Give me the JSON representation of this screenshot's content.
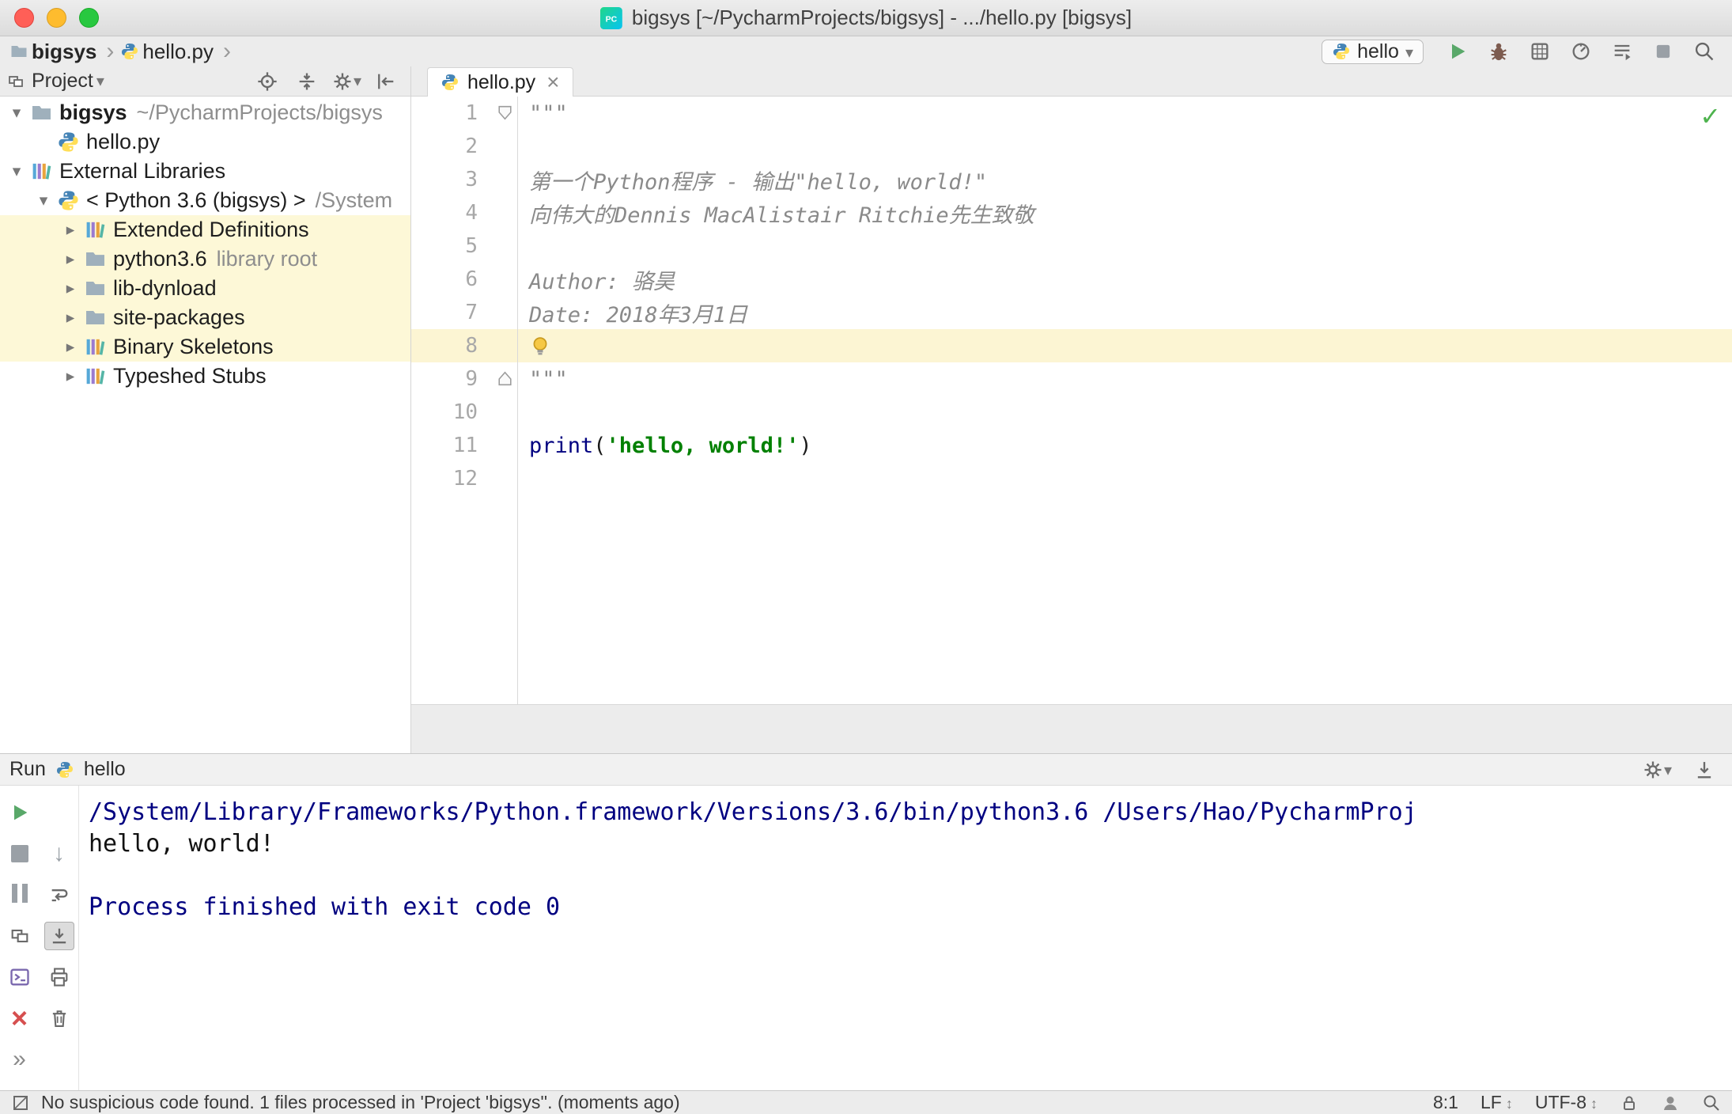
{
  "window": {
    "title": "bigsys [~/PycharmProjects/bigsys] - .../hello.py [bigsys]"
  },
  "navbar": {
    "breadcrumbs": [
      {
        "label": "bigsys"
      },
      {
        "label": "hello.py"
      }
    ],
    "run_config": {
      "label": "hello"
    }
  },
  "project_panel": {
    "title": "Project",
    "tree": [
      {
        "label": "bigsys",
        "suffix": "~/PycharmProjects/bigsys"
      },
      {
        "label": "hello.py"
      },
      {
        "label": "External Libraries"
      },
      {
        "label": "< Python 3.6 (bigsys) >",
        "suffix": "/System"
      },
      {
        "label": "Extended Definitions"
      },
      {
        "label": "python3.6",
        "suffix": "library root"
      },
      {
        "label": "lib-dynload"
      },
      {
        "label": "site-packages"
      },
      {
        "label": "Binary Skeletons"
      },
      {
        "label": "Typeshed Stubs"
      }
    ]
  },
  "editor": {
    "tab": "hello.py",
    "lines": [
      {
        "num": 1,
        "segments": [
          {
            "text": "\"\"\"",
            "style": "doc"
          }
        ]
      },
      {
        "num": 2,
        "segments": []
      },
      {
        "num": 3,
        "segments": [
          {
            "text": "第一个Python程序 - 输出\"hello, world!\"",
            "style": "doc"
          }
        ]
      },
      {
        "num": 4,
        "segments": [
          {
            "text": "向伟大的Dennis MacAlistair Ritchie先生致敬",
            "style": "doc"
          }
        ]
      },
      {
        "num": 5,
        "segments": []
      },
      {
        "num": 6,
        "segments": [
          {
            "text": "Author: 骆昊",
            "style": "doc"
          }
        ]
      },
      {
        "num": 7,
        "segments": [
          {
            "text": "Date: 2018年3月1日",
            "style": "doc"
          }
        ]
      },
      {
        "num": 8,
        "segments": []
      },
      {
        "num": 9,
        "segments": [
          {
            "text": "\"\"\"",
            "style": "doc"
          }
        ]
      },
      {
        "num": 10,
        "segments": []
      },
      {
        "num": 11,
        "segments": [
          {
            "text": "print",
            "style": "builtin"
          },
          {
            "text": "(",
            "style": "plain"
          },
          {
            "text": "'hello, world!'",
            "style": "string"
          },
          {
            "text": ")",
            "style": "plain"
          }
        ]
      },
      {
        "num": 12,
        "segments": []
      }
    ]
  },
  "run_panel": {
    "title": "Run",
    "config": "hello",
    "console": [
      {
        "text": "/System/Library/Frameworks/Python.framework/Versions/3.6/bin/python3.6 /Users/Hao/PycharmProj",
        "style": "system"
      },
      {
        "text": "hello, world!",
        "style": "stdout"
      },
      {
        "text": "",
        "style": "stdout"
      },
      {
        "text": "Process finished with exit code 0",
        "style": "system"
      }
    ]
  },
  "status_bar": {
    "message": "No suspicious code found. 1 files processed in 'Project 'bigsys''. (moments ago)",
    "position": "8:1",
    "line_separator": "LF",
    "encoding": "UTF-8"
  },
  "colors": {
    "run_green": "#59a869",
    "console_system_blue": "#000080",
    "string_green": "#008000",
    "editor_line_highlight": "#fcf5d3",
    "tree_highlight": "#fdf8d7"
  }
}
